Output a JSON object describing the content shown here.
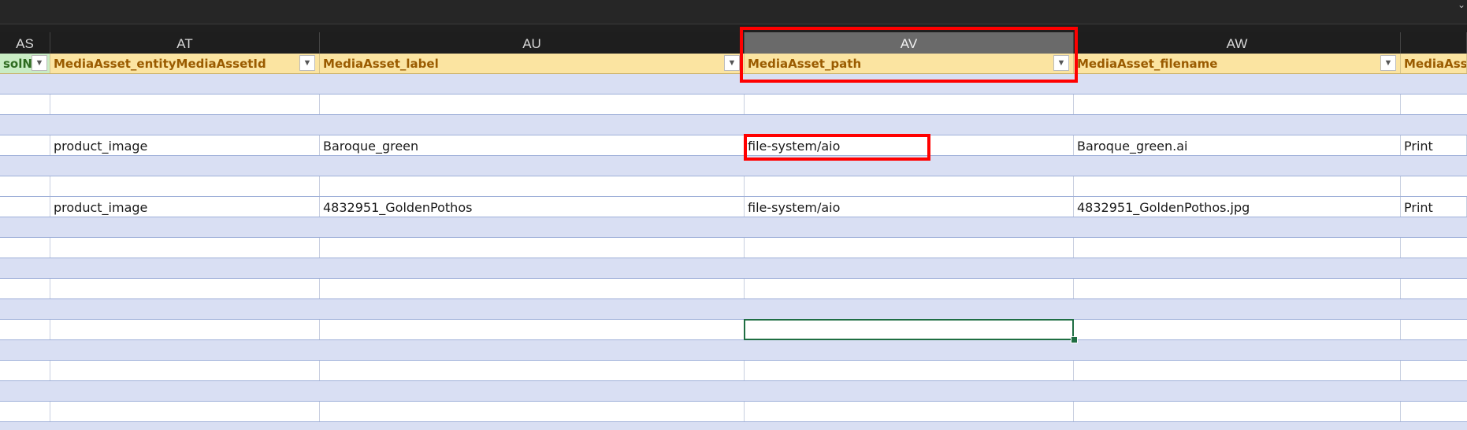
{
  "topbar": {
    "corner_icon": "chevron-down-icon"
  },
  "columns": {
    "letters": [
      "AS",
      "AT",
      "AU",
      "AV",
      "AW"
    ],
    "selected": "AV"
  },
  "header": {
    "as": "solN",
    "at": "MediaAsset_entityMediaAssetId",
    "au": "MediaAsset_label",
    "av": "MediaAsset_path",
    "aw": "MediaAsset_filename",
    "ax": "MediaAsse"
  },
  "rows": {
    "r3": {
      "at": "product_image",
      "au": "Baroque_green",
      "av": "file-system/aio",
      "aw": "Baroque_green.ai",
      "ax": "Print"
    },
    "r6": {
      "at": "product_image",
      "au": "4832951_GoldenPothos",
      "av": "file-system/aio",
      "aw": "4832951_GoldenPothos.jpg",
      "ax": "Print"
    }
  },
  "colors": {
    "header_fill": "#fbe4a1",
    "band_fill": "#d9dff3",
    "selection_border": "#1f6e43",
    "annotation": "#ff0000"
  }
}
